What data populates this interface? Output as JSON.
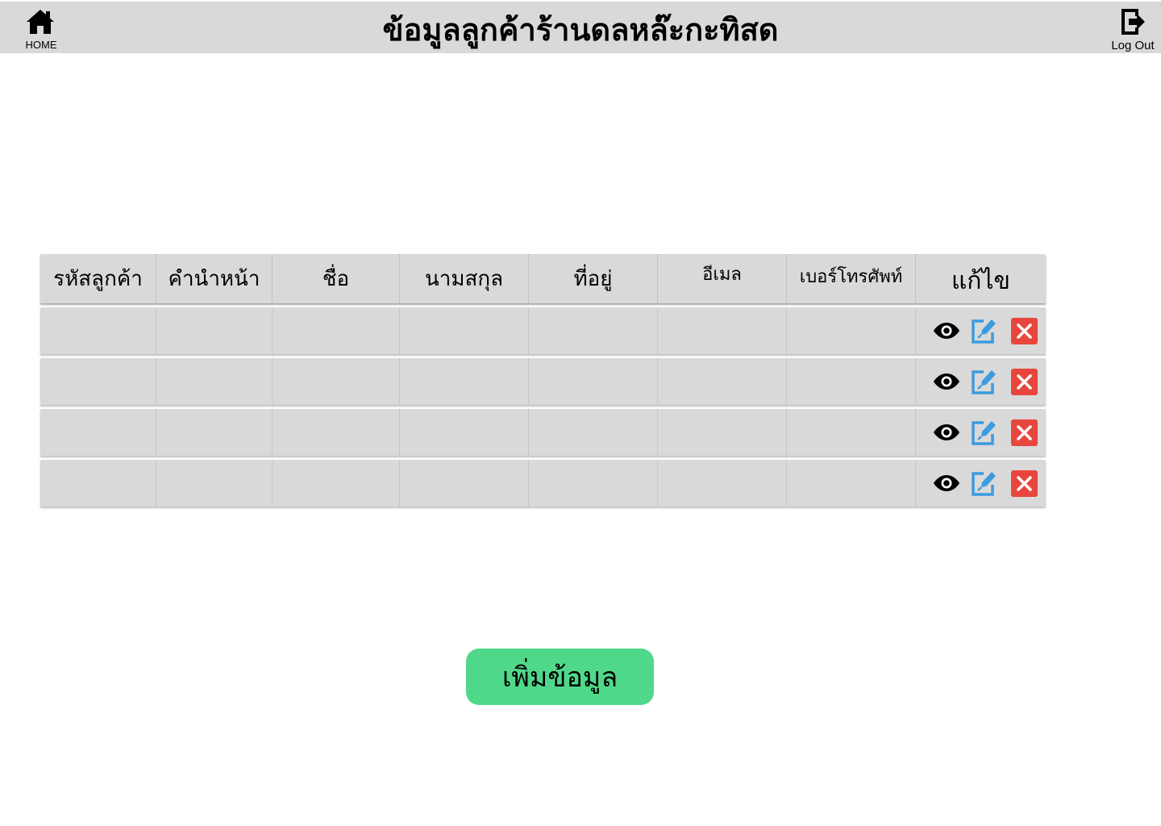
{
  "header": {
    "title": "ข้อมูลลูกค้าร้านดลหล๊ะกะทิสด",
    "home_label": "HOME",
    "logout_label": "Log Out",
    "home_icon": "home-icon",
    "logout_icon": "logout-icon",
    "background": "#d9d9d9"
  },
  "table": {
    "columns": [
      "รหัสลูกค้า",
      "คำนำหน้า",
      "ชื่อ",
      "นามสกุล",
      "ที่อยู่",
      "อีเมล",
      "เบอร์โทรศัพท์",
      "แก้ไข"
    ],
    "rows": [
      {
        "cells": [
          "",
          "",
          "",
          "",
          "",
          "",
          ""
        ]
      },
      {
        "cells": [
          "",
          "",
          "",
          "",
          "",
          "",
          ""
        ]
      },
      {
        "cells": [
          "",
          "",
          "",
          "",
          "",
          "",
          ""
        ]
      },
      {
        "cells": [
          "",
          "",
          "",
          "",
          "",
          "",
          ""
        ]
      }
    ],
    "actions": {
      "view_icon": "eye-icon",
      "edit_icon": "edit-icon",
      "delete_icon": "close-icon",
      "edit_color": "#3d9be0",
      "delete_color": "#e8463c"
    }
  },
  "add_button": {
    "label": "เพิ่มข้อมูล",
    "color": "#50d88a"
  }
}
